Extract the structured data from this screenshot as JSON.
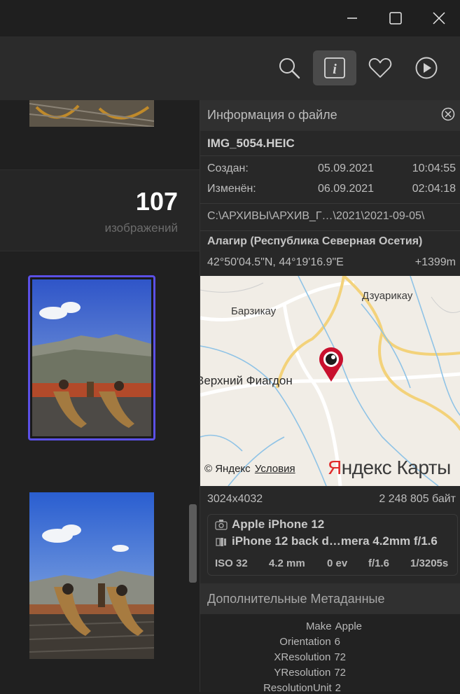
{
  "count": {
    "number": "107",
    "label": "изображений"
  },
  "panel": {
    "title": "Информация о файле",
    "filename": "IMG_5054.HEIC",
    "created_label": "Создан:",
    "created_date": "05.09.2021",
    "created_time": "10:04:55",
    "modified_label": "Изменён:",
    "modified_date": "06.09.2021",
    "modified_time": "02:04:18",
    "path": "C:\\АРХИВЫ\\АРХИВ_Г…\\2021\\2021-09-05\\",
    "location": "Алагир (Республика Северная Осетия)",
    "coords": "42°50'04.5\"N, 44°19'16.9\"E",
    "altitude": "+1399m",
    "resolution": "3024x4032",
    "filesize": "2 248 805 байт",
    "camera": "Apple iPhone 12",
    "lens": "iPhone 12 back d…mera 4.2mm f/1.6",
    "iso": "ISO 32",
    "focal": "4.2 mm",
    "ev": "0 ev",
    "aperture": "f/1.6",
    "shutter": "1/3205s",
    "meta_header": "Дополнительные Метаданные"
  },
  "map": {
    "label1": "Барзикау",
    "label2": "Дзуарикау",
    "label3": "Верхний Фиагдон",
    "copyright": "© Яндекс",
    "terms": "Условия",
    "brand_ya": "Я",
    "brand_rest": "ндекс Карты"
  },
  "metadata": [
    {
      "key": "Make",
      "value": "Apple"
    },
    {
      "key": "Orientation",
      "value": "6"
    },
    {
      "key": "XResolution",
      "value": "72"
    },
    {
      "key": "YResolution",
      "value": "72"
    },
    {
      "key": "ResolutionUnit",
      "value": "2"
    }
  ],
  "colors": {
    "accent": "#5b50e6",
    "pin": "#c8102e",
    "yandex_red": "#e02a2a"
  },
  "icons": [
    "minimize-icon",
    "maximize-icon",
    "close-icon",
    "search-icon",
    "info-icon",
    "heart-icon",
    "play-icon",
    "close-circle-icon",
    "camera-icon",
    "lens-icon",
    "map-pin-icon"
  ]
}
